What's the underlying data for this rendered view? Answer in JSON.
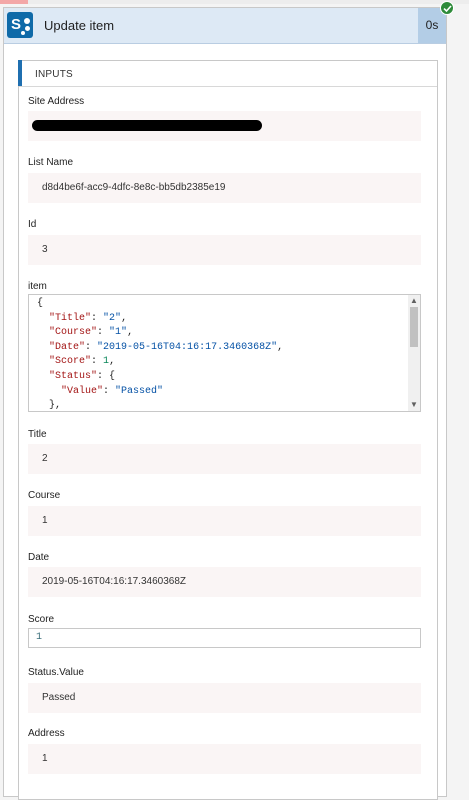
{
  "header": {
    "title": "Update item",
    "duration": "0s",
    "logo_letter": "S",
    "status": "succeeded"
  },
  "inputs": {
    "section_label": "INPUTS",
    "site_address": {
      "label": "Site Address",
      "value": ""
    },
    "list_name": {
      "label": "List Name",
      "value": "d8d4be6f-acc9-4dfc-8e8c-bb5db2385e19"
    },
    "id": {
      "label": "Id",
      "value": "3"
    },
    "item": {
      "label": "item",
      "json_lines": [
        [
          {
            "t": "{",
            "c": "p"
          }
        ],
        [
          {
            "t": "  ",
            "c": "p"
          },
          {
            "t": "\"Title\"",
            "c": "k"
          },
          {
            "t": ": ",
            "c": "p"
          },
          {
            "t": "\"2\"",
            "c": "s"
          },
          {
            "t": ",",
            "c": "p"
          }
        ],
        [
          {
            "t": "  ",
            "c": "p"
          },
          {
            "t": "\"Course\"",
            "c": "k"
          },
          {
            "t": ": ",
            "c": "p"
          },
          {
            "t": "\"1\"",
            "c": "s"
          },
          {
            "t": ",",
            "c": "p"
          }
        ],
        [
          {
            "t": "  ",
            "c": "p"
          },
          {
            "t": "\"Date\"",
            "c": "k"
          },
          {
            "t": ": ",
            "c": "p"
          },
          {
            "t": "\"2019-05-16T04:16:17.3460368Z\"",
            "c": "s"
          },
          {
            "t": ",",
            "c": "p"
          }
        ],
        [
          {
            "t": "  ",
            "c": "p"
          },
          {
            "t": "\"Score\"",
            "c": "k"
          },
          {
            "t": ": ",
            "c": "p"
          },
          {
            "t": "1",
            "c": "n"
          },
          {
            "t": ",",
            "c": "p"
          }
        ],
        [
          {
            "t": "  ",
            "c": "p"
          },
          {
            "t": "\"Status\"",
            "c": "k"
          },
          {
            "t": ": {",
            "c": "p"
          }
        ],
        [
          {
            "t": "    ",
            "c": "p"
          },
          {
            "t": "\"Value\"",
            "c": "k"
          },
          {
            "t": ": ",
            "c": "p"
          },
          {
            "t": "\"Passed\"",
            "c": "s"
          }
        ],
        [
          {
            "t": "  },",
            "c": "p"
          }
        ]
      ]
    },
    "title": {
      "label": "Title",
      "value": "2"
    },
    "course": {
      "label": "Course",
      "value": "1"
    },
    "date": {
      "label": "Date",
      "value": "2019-05-16T04:16:17.3460368Z"
    },
    "score": {
      "label": "Score",
      "value": "1"
    },
    "status_value": {
      "label": "Status.Value",
      "value": "Passed"
    },
    "address": {
      "label": "Address",
      "value": "1"
    }
  },
  "colors": {
    "header_bg": "#dde9f5",
    "duration_bg": "#b3cde6",
    "logo_bg": "#0f6aa8",
    "success_green": "#2e8b3a",
    "accent_blue": "#1f6fb0",
    "value_bg": "#faf5f5"
  },
  "icons": {
    "logo": "sharepoint-logo-icon",
    "status": "checkmark-circle-icon",
    "scroll_up": "chevron-up-icon",
    "scroll_down": "chevron-down-icon"
  }
}
